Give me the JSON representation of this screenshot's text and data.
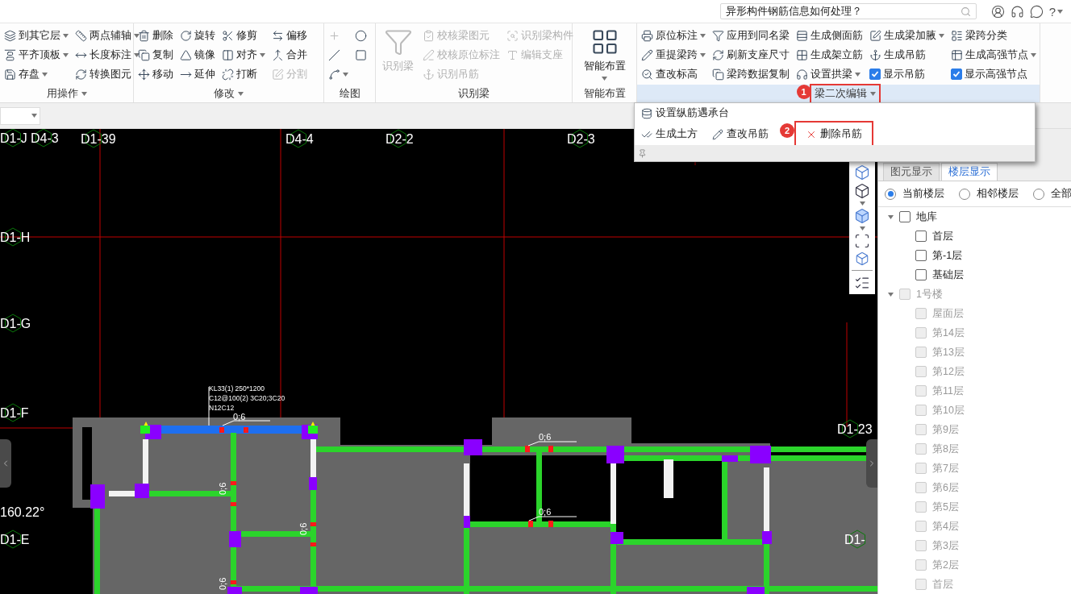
{
  "top_bar": {
    "search": {
      "value": "异形构件钢筋信息如何处理？"
    },
    "help_label": "?"
  },
  "ribbon": {
    "groups": [
      {
        "label": "用操作",
        "label_dropdown": true,
        "highlighted": false,
        "columns": [
          [
            {
              "kind": "button",
              "label": "到其它层",
              "dropdown": true,
              "disabled": false
            },
            {
              "kind": "button",
              "label": "平齐顶板",
              "dropdown": true,
              "disabled": false
            },
            {
              "kind": "button",
              "label": "存盘",
              "dropdown": true,
              "disabled": false
            }
          ],
          [
            {
              "kind": "button",
              "label": "两点辅轴",
              "dropdown": true,
              "disabled": false
            },
            {
              "kind": "button",
              "label": "长度标注",
              "dropdown": true,
              "disabled": false
            },
            {
              "kind": "button",
              "label": "转换图元",
              "dropdown": false,
              "disabled": false
            }
          ]
        ]
      },
      {
        "label": "修改",
        "label_dropdown": true,
        "highlighted": false,
        "columns": [
          [
            {
              "kind": "button",
              "label": "删除",
              "dropdown": false,
              "disabled": false
            },
            {
              "kind": "button",
              "label": "复制",
              "dropdown": false,
              "disabled": false
            },
            {
              "kind": "button",
              "label": "移动",
              "dropdown": false,
              "disabled": false
            }
          ],
          [
            {
              "kind": "button",
              "label": "旋转",
              "dropdown": false,
              "disabled": false
            },
            {
              "kind": "button",
              "label": "镜像",
              "dropdown": false,
              "disabled": false
            },
            {
              "kind": "button",
              "label": "延伸",
              "dropdown": false,
              "disabled": false
            }
          ],
          [
            {
              "kind": "button",
              "label": "修剪",
              "dropdown": false,
              "disabled": false
            },
            {
              "kind": "button",
              "label": "对齐",
              "dropdown": true,
              "disabled": false
            },
            {
              "kind": "button",
              "label": "打断",
              "dropdown": false,
              "disabled": false
            }
          ],
          [
            {
              "kind": "button",
              "label": "偏移",
              "dropdown": false,
              "disabled": false
            },
            {
              "kind": "button",
              "label": "合并",
              "dropdown": false,
              "disabled": false
            },
            {
              "kind": "button",
              "label": "分割",
              "dropdown": false,
              "disabled": true
            }
          ]
        ]
      },
      {
        "label": "绘图",
        "label_dropdown": false,
        "highlighted": false,
        "columns": [
          [
            {
              "kind": "icon",
              "dropdown": false,
              "disabled": true
            },
            {
              "kind": "icon",
              "dropdown": false,
              "disabled": false
            },
            {
              "kind": "icon",
              "dropdown": true,
              "disabled": false
            }
          ],
          [
            {
              "kind": "icon",
              "dropdown": false,
              "disabled": false
            },
            {
              "kind": "icon",
              "dropdown": false,
              "disabled": false
            }
          ]
        ]
      },
      {
        "label": "识别梁",
        "label_dropdown": false,
        "highlighted": false,
        "big_button": {
          "label": "识别梁",
          "dropdown": false,
          "disabled": true
        },
        "columns": [
          [
            {
              "kind": "button",
              "label": "校核梁图元",
              "dropdown": false,
              "disabled": true
            },
            {
              "kind": "button",
              "label": "校核原位标注",
              "dropdown": false,
              "disabled": true
            },
            {
              "kind": "button",
              "label": "识别吊筋",
              "dropdown": false,
              "disabled": true
            }
          ],
          [
            {
              "kind": "button",
              "label": "识别梁构件",
              "dropdown": false,
              "disabled": true
            },
            {
              "kind": "button",
              "label": "编辑支座",
              "dropdown": false,
              "disabled": true
            }
          ]
        ]
      },
      {
        "label": "智能布置",
        "label_dropdown": false,
        "highlighted": false,
        "big_button": {
          "label": "智能布置",
          "dropdown": true,
          "disabled": false
        }
      },
      {
        "label": "梁二次编辑",
        "label_dropdown": true,
        "highlighted": true,
        "badge": "1",
        "columns": [
          [
            {
              "kind": "button",
              "label": "原位标注",
              "dropdown": true,
              "disabled": false
            },
            {
              "kind": "button",
              "label": "重提梁跨",
              "dropdown": true,
              "disabled": false
            },
            {
              "kind": "button",
              "label": "查改标高",
              "dropdown": false,
              "disabled": false
            }
          ],
          [
            {
              "kind": "button",
              "label": "应用到同名梁",
              "dropdown": false,
              "disabled": false
            },
            {
              "kind": "button",
              "label": "刷新支座尺寸",
              "dropdown": false,
              "disabled": false
            },
            {
              "kind": "button",
              "label": "梁跨数据复制",
              "dropdown": false,
              "disabled": false
            }
          ],
          [
            {
              "kind": "button",
              "label": "生成侧面筋",
              "dropdown": false,
              "disabled": false
            },
            {
              "kind": "button",
              "label": "生成架立筋",
              "dropdown": false,
              "disabled": false
            },
            {
              "kind": "button",
              "label": "设置拱梁",
              "dropdown": true,
              "disabled": false
            }
          ],
          [
            {
              "kind": "button",
              "label": "生成梁加腋",
              "dropdown": true,
              "disabled": false
            },
            {
              "kind": "button",
              "label": "生成吊筋",
              "dropdown": false,
              "disabled": false
            },
            {
              "kind": "checkbox",
              "label": "显示吊筋",
              "checked": true
            }
          ],
          [
            {
              "kind": "button",
              "label": "梁跨分类",
              "dropdown": false,
              "disabled": false
            },
            {
              "kind": "button",
              "label": "生成高强节点",
              "dropdown": true,
              "disabled": false
            },
            {
              "kind": "checkbox",
              "label": "显示高强节点",
              "checked": true
            }
          ]
        ]
      }
    ]
  },
  "popup": {
    "rows": [
      [
        {
          "label": "设置纵筋遇承台",
          "highlighted": false
        }
      ],
      [
        {
          "label": "生成土方",
          "highlighted": false
        },
        {
          "label": "查改吊筋",
          "highlighted": false
        },
        {
          "label": "删除吊筋",
          "highlighted": true,
          "badge": "2"
        }
      ]
    ]
  },
  "canvas": {
    "axis_labels": [
      "D1-J",
      "D4-3",
      "D1-39",
      "D4-4",
      "D2-2",
      "D2-3",
      "D1-H",
      "D1-G",
      "D1-F",
      "D1-E",
      "D1-23",
      "D1-"
    ],
    "angle": "160.22°",
    "beam_annotation": [
      "KL33(1) 250*1200",
      "C12@100(2) 3C20;3C20",
      "N12C12"
    ],
    "dimension_labels": [
      "0;6",
      "0;6",
      "0;6",
      "0;6",
      "0;6",
      "0;6"
    ]
  },
  "right_panel": {
    "tabs": [
      {
        "label": "图元显示",
        "selected": false
      },
      {
        "label": "楼层显示",
        "selected": true
      }
    ],
    "radios": [
      {
        "label": "当前楼层",
        "selected": true
      },
      {
        "label": "相邻楼层",
        "selected": false
      },
      {
        "label": "全部",
        "selected": false
      }
    ],
    "tree": [
      {
        "label": "地库",
        "checked": false,
        "disabled": false,
        "expanded": true,
        "children": [
          {
            "label": "首层",
            "checked": false,
            "disabled": false
          },
          {
            "label": "第-1层",
            "checked": false,
            "disabled": false
          },
          {
            "label": "基础层",
            "checked": false,
            "disabled": false
          }
        ]
      },
      {
        "label": "1号楼",
        "checked": false,
        "disabled": true,
        "expanded": true,
        "children": [
          {
            "label": "屋面层",
            "checked": false,
            "disabled": true
          },
          {
            "label": "第14层",
            "checked": false,
            "disabled": true
          },
          {
            "label": "第13层",
            "checked": false,
            "disabled": true
          },
          {
            "label": "第12层",
            "checked": false,
            "disabled": true
          },
          {
            "label": "第11层",
            "checked": false,
            "disabled": true
          },
          {
            "label": "第10层",
            "checked": false,
            "disabled": true
          },
          {
            "label": "第9层",
            "checked": false,
            "disabled": true
          },
          {
            "label": "第8层",
            "checked": false,
            "disabled": true
          },
          {
            "label": "第7层",
            "checked": false,
            "disabled": true
          },
          {
            "label": "第6层",
            "checked": false,
            "disabled": true
          },
          {
            "label": "第5层",
            "checked": false,
            "disabled": true
          },
          {
            "label": "第4层",
            "checked": false,
            "disabled": true
          },
          {
            "label": "第3层",
            "checked": false,
            "disabled": true
          },
          {
            "label": "第2层",
            "checked": false,
            "disabled": true
          },
          {
            "label": "首层",
            "checked": false,
            "disabled": true
          }
        ]
      }
    ]
  }
}
